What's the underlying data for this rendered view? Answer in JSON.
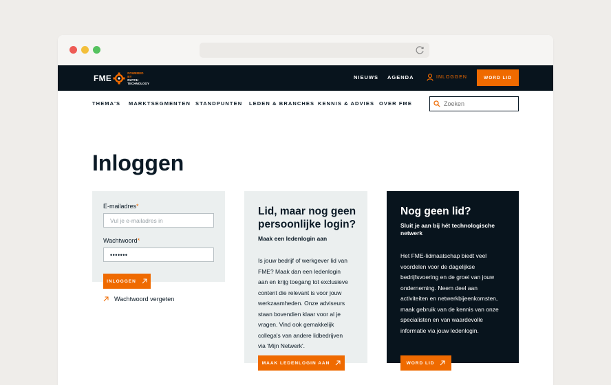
{
  "browser": {
    "reload_icon": "reload-icon"
  },
  "header": {
    "logo": {
      "brand": "FME",
      "tagline": [
        "POWERED",
        "BY",
        "DUTCH",
        "TECHNOLOGY"
      ]
    },
    "top_links": [
      {
        "label": "NIEUWS"
      },
      {
        "label": "AGENDA"
      }
    ],
    "login_label": "INLOGGEN",
    "join_button": "WORD LID",
    "main_nav": [
      {
        "label": "THEMA'S"
      },
      {
        "label": "MARKTSEGMENTEN"
      },
      {
        "label": "STANDPUNTEN"
      },
      {
        "label": "LEDEN & BRANCHES"
      },
      {
        "label": "KENNIS & ADVIES"
      },
      {
        "label": "OVER FME"
      }
    ],
    "search_placeholder": "Zoeken"
  },
  "main": {
    "title": "Inloggen",
    "login_form": {
      "email_label": "E-mailadres",
      "email_placeholder": "Vul je e-mailadres in",
      "password_label": "Wachtwoord",
      "password_value": "•••••••",
      "required_mark": "*",
      "submit_label": "INLOGGEN",
      "forgot_label": "Wachtwoord vergeten"
    },
    "member_card": {
      "title_line1": "Lid, maar nog geen",
      "title_line2": "persoonlijke login?",
      "subtitle": "Maak een ledenlogin aan",
      "body": [
        "Is jouw bedrijf of werkgever lid van",
        "FME? Maak dan een ledenlogin",
        "aan en krijg toegang tot exclusieve",
        "content die relevant is voor jouw",
        "werkzaamheden. Onze adviseurs",
        "staan bovendien klaar voor al je",
        "vragen. Vind ook gemakkelijk",
        "collega's van andere lidbedrijven",
        "via 'Mijn Netwerk'."
      ],
      "button_label": "MAAK LEDENLOGIN AAN"
    },
    "join_card": {
      "title": "Nog geen lid?",
      "subtitle_line1": "Sluit je aan bij hét technologische",
      "subtitle_line2": "netwerk",
      "body": [
        "Het FME-lidmaatschap biedt veel",
        "voordelen voor de dagelijkse",
        "bedrijfsvoering en de groei van jouw",
        "onderneming. Neem deel aan",
        "activiteiten en netwerkbijeenkomsten,",
        "maak gebruik van de kennis van onze",
        "specialisten en van waardevolle",
        "informatie via jouw ledenlogin."
      ],
      "button_label": "WORD LID"
    }
  },
  "colors": {
    "accent": "#ef6a00",
    "dark": "#08141d",
    "panel": "#ebefef"
  }
}
